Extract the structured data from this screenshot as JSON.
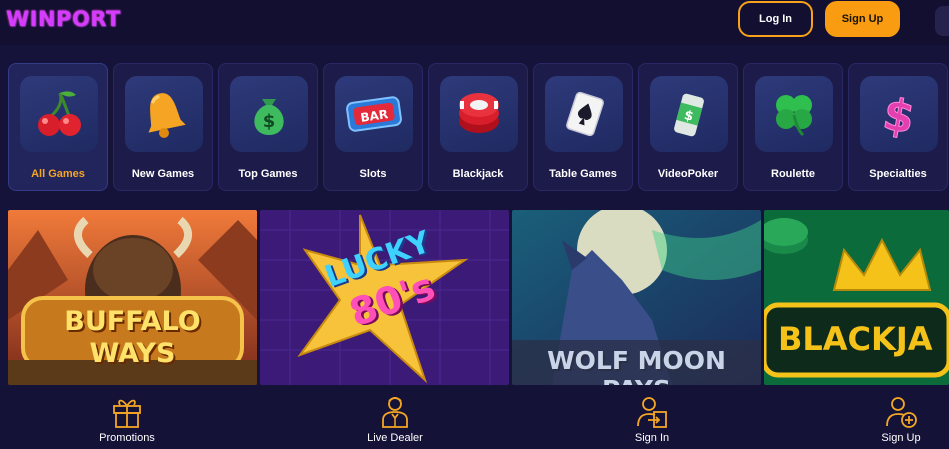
{
  "header": {
    "logo_text": "WINPORT",
    "login_label": "Log In",
    "signup_label": "Sign Up"
  },
  "categories": [
    {
      "label": "All Games",
      "icon": "cherries-icon",
      "active": true
    },
    {
      "label": "New Games",
      "icon": "bell-icon",
      "active": false
    },
    {
      "label": "Top Games",
      "icon": "money-bag-icon",
      "active": false
    },
    {
      "label": "Slots",
      "icon": "bar-slot-icon",
      "active": false
    },
    {
      "label": "Blackjack",
      "icon": "casino-chip-icon",
      "active": false
    },
    {
      "label": "Table Games",
      "icon": "playing-card-icon",
      "active": false
    },
    {
      "label": "VideoPoker",
      "icon": "cash-roll-icon",
      "active": false
    },
    {
      "label": "Roulette",
      "icon": "clover-icon",
      "active": false
    },
    {
      "label": "Specialties",
      "icon": "dollar-sign-icon",
      "active": false
    }
  ],
  "games": [
    {
      "title_line1": "BUFFALO",
      "title_line2": "WAYS"
    },
    {
      "title_line1": "LUCKY",
      "title_line2": "80's"
    },
    {
      "title_line1": "WOLF MOON PAYS",
      "title_line2": ""
    },
    {
      "title_line1": "BLACKJA",
      "title_line2": ""
    }
  ],
  "bottom_nav": [
    {
      "label": "Promotions",
      "icon": "gift-icon"
    },
    {
      "label": "Live Dealer",
      "icon": "dealer-icon"
    },
    {
      "label": "Sign In",
      "icon": "sign-in-icon"
    },
    {
      "label": "Sign Up",
      "icon": "add-user-icon"
    }
  ],
  "colors": {
    "accent": "#f99c11",
    "background": "#16133a",
    "active_label": "#f5a623"
  }
}
